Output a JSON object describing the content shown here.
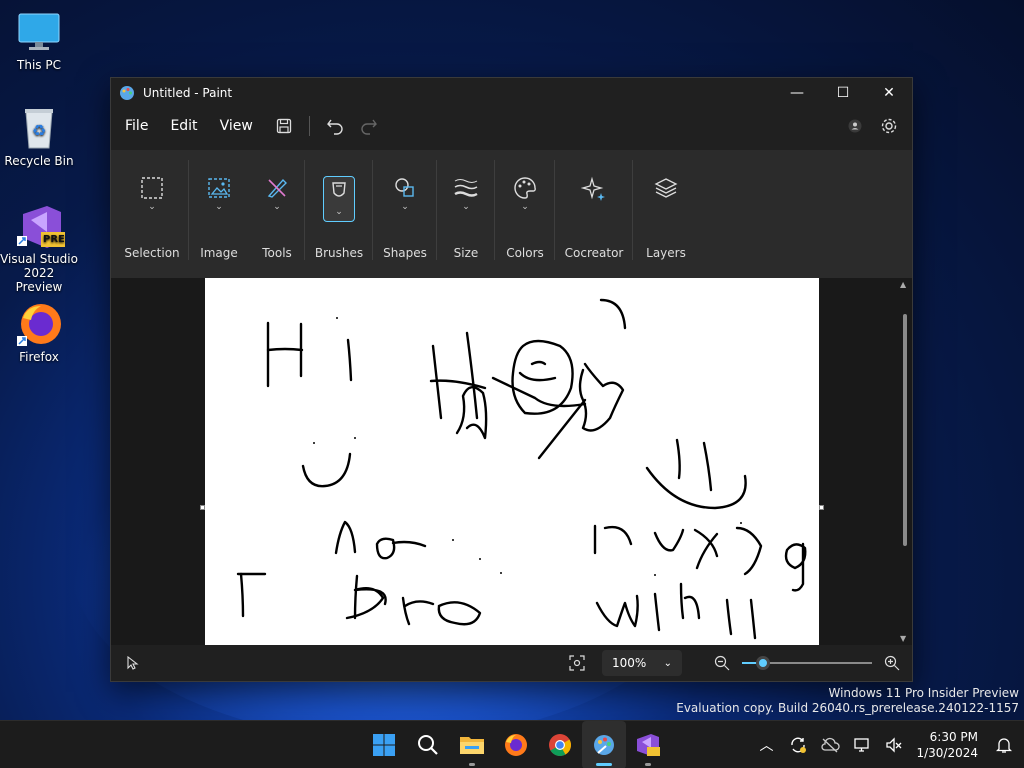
{
  "desktop": {
    "icons": [
      {
        "label": "This PC"
      },
      {
        "label": "Recycle Bin"
      },
      {
        "label": "Visual Studio 2022 Preview",
        "badge": "PRE"
      },
      {
        "label": "Firefox"
      }
    ]
  },
  "window": {
    "title": "Untitled - Paint",
    "controls": {
      "minimize": "—",
      "maximize": "☐",
      "close": "✕"
    }
  },
  "menu": {
    "file": "File",
    "edit": "Edit",
    "view": "View"
  },
  "ribbon": {
    "groups": [
      {
        "label": "Selection",
        "icon": "selection-icon"
      },
      {
        "label": "Image",
        "icon": "image-icon"
      },
      {
        "label": "Tools",
        "icon": "tools-icon"
      },
      {
        "label": "Brushes",
        "icon": "brush-icon",
        "active": true
      },
      {
        "label": "Shapes",
        "icon": "shapes-icon"
      },
      {
        "label": "Size",
        "icon": "size-icon"
      },
      {
        "label": "Colors",
        "icon": "palette-icon"
      },
      {
        "label": "Cocreator",
        "icon": "sparkle-icon"
      },
      {
        "label": "Layers",
        "icon": "layers-icon"
      }
    ]
  },
  "status": {
    "zoom": "100%",
    "zoom_fraction": 0.16
  },
  "watermark": {
    "line1": "Windows 11 Pro Insider Preview",
    "line2": "Evaluation copy. Build 26040.rs_prerelease.240122-1157"
  },
  "clock": {
    "time": "6:30 PM",
    "date": "1/30/2024"
  },
  "colors": {
    "accent": "#60cdff",
    "window_bg": "#202020",
    "ribbon_bg": "#2b2b2b"
  }
}
